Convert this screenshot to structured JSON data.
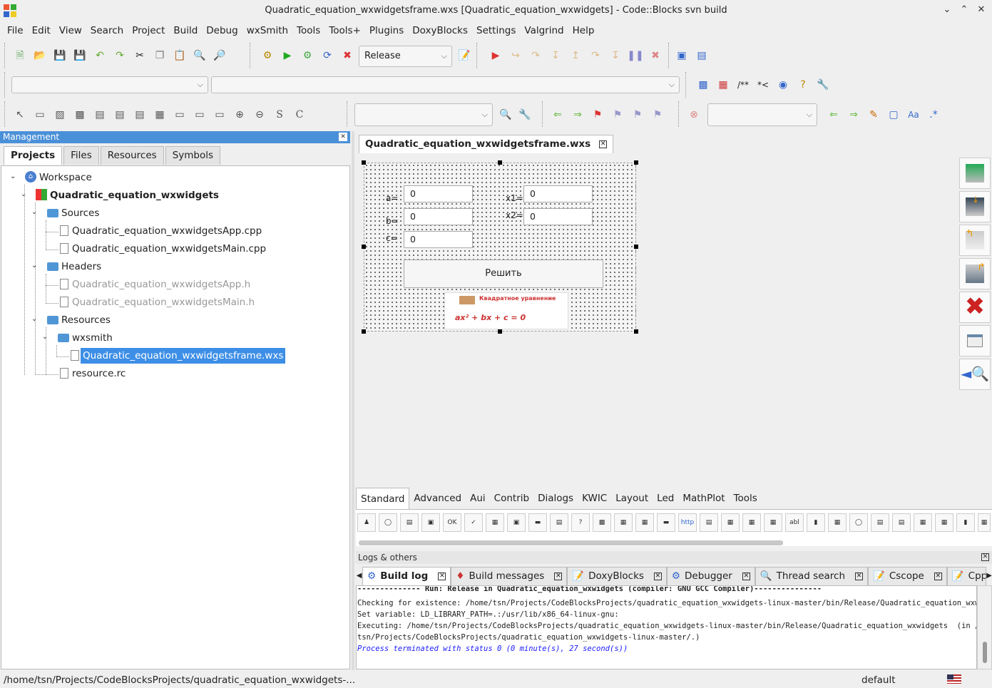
{
  "window": {
    "title": "Quadratic_equation_wxwidgetsframe.wxs [Quadratic_equation_wxwidgets] - Code::Blocks svn build"
  },
  "menu": [
    "File",
    "Edit",
    "View",
    "Search",
    "Project",
    "Build",
    "Debug",
    "wxSmith",
    "Tools",
    "Tools+",
    "Plugins",
    "DoxyBlocks",
    "Settings",
    "Valgrind",
    "Help"
  ],
  "toolbar": {
    "build_target": "Release"
  },
  "management": {
    "title": "Management",
    "tabs": [
      "Projects",
      "Files",
      "Resources",
      "Symbols"
    ],
    "tree": {
      "workspace": "Workspace",
      "project": "Quadratic_equation_wxwidgets",
      "sources": "Sources",
      "source_files": [
        "Quadratic_equation_wxwidgetsApp.cpp",
        "Quadratic_equation_wxwidgetsMain.cpp"
      ],
      "headers": "Headers",
      "header_files": [
        "Quadratic_equation_wxwidgetsApp.h",
        "Quadratic_equation_wxwidgetsMain.h"
      ],
      "resources": "Resources",
      "wxsmith": "wxsmith",
      "wxs_file": "Quadratic_equation_wxwidgetsframe.wxs",
      "rc_file": "resource.rc"
    }
  },
  "editor": {
    "tab": "Quadratic_equation_wxwidgetsframe.wxs",
    "form": {
      "a_label": "a=",
      "a_value": "0",
      "b_label": "b=",
      "b_value": "0",
      "c_label": "c=",
      "c_value": "0",
      "x1_label": "x1=",
      "x1_value": "0",
      "x2_label": "x2=",
      "x2_value": "0",
      "solve_button": "Решить",
      "image_title": "Квадратное уравнение",
      "image_formula": "ax² + bx + c = 0"
    }
  },
  "palette": {
    "tabs": [
      "Standard",
      "Advanced",
      "Aui",
      "Contrib",
      "Dialogs",
      "KWIC",
      "Layout",
      "Led",
      "MathPlot",
      "Tools"
    ],
    "active": "Standard"
  },
  "logs": {
    "title": "Logs & others",
    "tabs": [
      "Build log",
      "Build messages",
      "DoxyBlocks",
      "Debugger",
      "Thread search",
      "Cscope",
      "CppChecki"
    ],
    "lines": [
      "-------------- Run: Release in Quadratic_equation_wxwidgets (compiler: GNU GCC Compiler)---------------",
      "Checking for existence: /home/tsn/Projects/CodeBlocksProjects/quadratic_equation_wxwidgets-linux-master/bin/Release/Quadratic_equation_wxwidgets",
      "Set variable: LD_LIBRARY_PATH=.:/usr/lib/x86_64-linux-gnu:",
      "Executing: /home/tsn/Projects/CodeBlocksProjects/quadratic_equation_wxwidgets-linux-master/bin/Release/Quadratic_equation_wxwidgets  (in /home/",
      "tsn/Projects/CodeBlocksProjects/quadratic_equation_wxwidgets-linux-master/.)"
    ],
    "status_line": "Process terminated with status 0 (0 minute(s), 27 second(s))"
  },
  "statusbar": {
    "path": "/home/tsn/Projects/CodeBlocksProjects/quadratic_equation_wxwidgets-...",
    "profile": "default"
  }
}
